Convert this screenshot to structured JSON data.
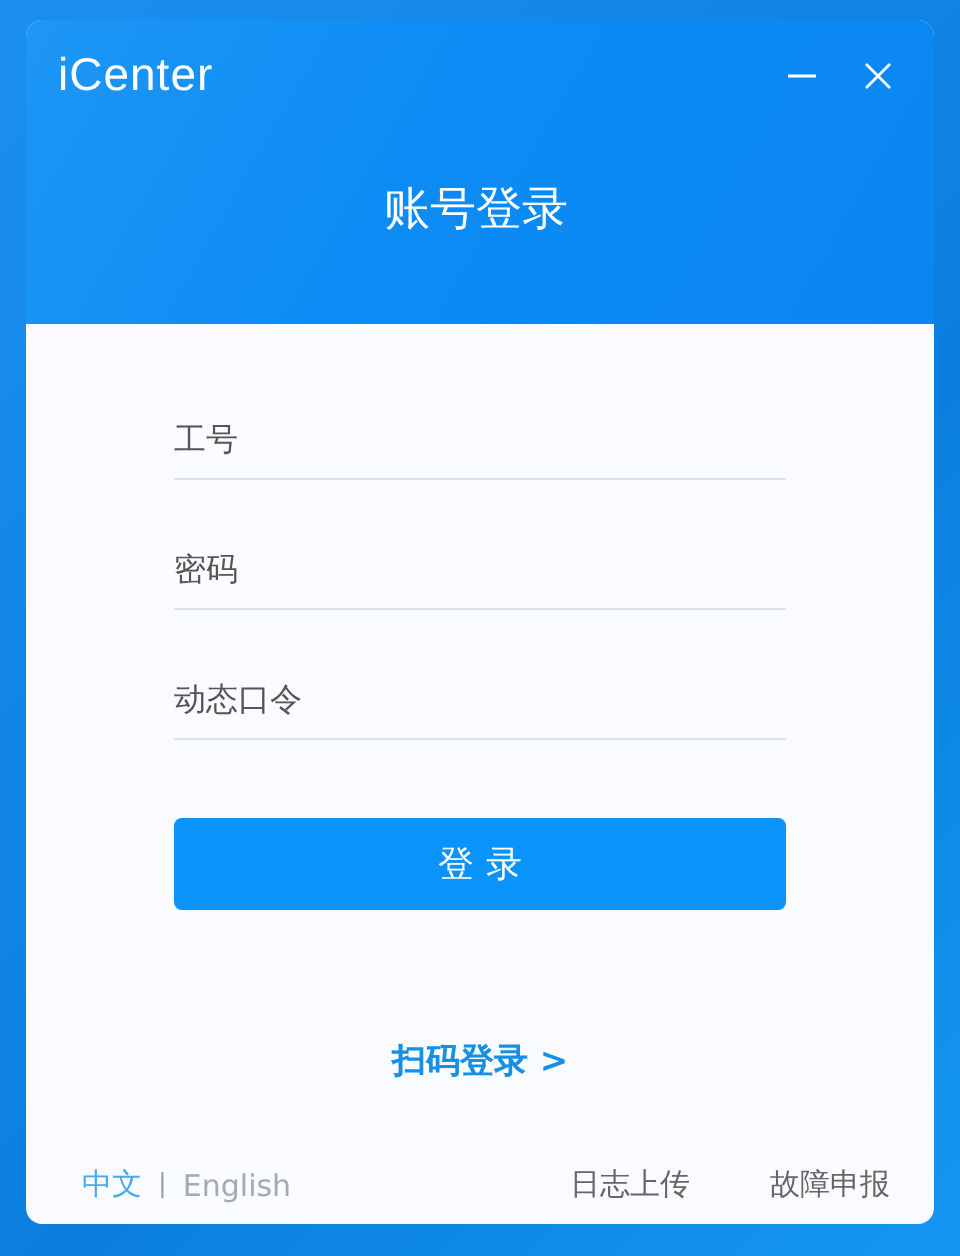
{
  "window": {
    "logo": "iCenter",
    "title": "账号登录"
  },
  "fields": [
    {
      "placeholder": "工号"
    },
    {
      "placeholder": "密码"
    },
    {
      "placeholder": "动态口令"
    }
  ],
  "login_button": "登 录",
  "qr_login": "扫码登录 >",
  "languages": [
    {
      "label": "中文",
      "selected": true
    },
    {
      "label": "English",
      "selected": false
    }
  ],
  "language_separator": "|",
  "footer_links": [
    "日志上传",
    "故障申报"
  ]
}
